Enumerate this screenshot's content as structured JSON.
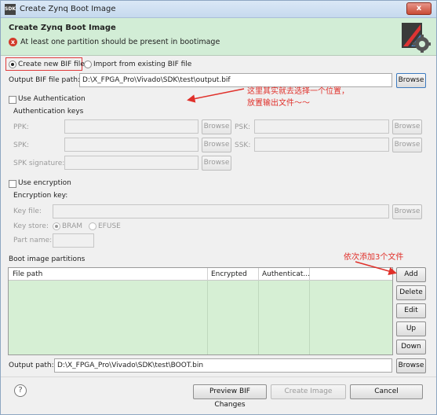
{
  "window": {
    "title": "Create Zynq Boot Image",
    "app_icon_text": "SDK",
    "close_label": "x"
  },
  "header": {
    "title": "Create Zynq Boot Image",
    "message": "At least one partition should be present in bootimage",
    "error_icon": "x"
  },
  "bif_mode": {
    "create_new_label": "Create new BIF file",
    "import_label": "Import from existing BIF file",
    "selected": "create_new"
  },
  "output_bif": {
    "label": "Output BIF file path:",
    "value": "D:\\X_FPGA_Pro\\Vivado\\SDK\\test\\output.bif",
    "browse": "Browse"
  },
  "authentication": {
    "checkbox_label": "Use Authentication",
    "keys_label": "Authentication keys",
    "ppk_label": "PPK:",
    "psk_label": "PSK:",
    "spk_label": "SPK:",
    "ssk_label": "SSK:",
    "spk_sig_label": "SPK signature:",
    "browse": "Browse"
  },
  "encryption": {
    "checkbox_label": "Use encryption",
    "key_section_label": "Encryption key:",
    "key_file_label": "Key file:",
    "key_store_label": "Key store:",
    "bram_label": "BRAM",
    "efuse_label": "EFUSE",
    "part_name_label": "Part name:",
    "browse": "Browse"
  },
  "partitions": {
    "section_label": "Boot image partitions",
    "columns": [
      "File path",
      "Encrypted",
      "Authenticat..."
    ],
    "buttons": {
      "add": "Add",
      "delete": "Delete",
      "edit": "Edit",
      "up": "Up",
      "down": "Down"
    }
  },
  "output_path": {
    "label": "Output path:",
    "value": "D:\\X_FPGA_Pro\\Vivado\\SDK\\test\\BOOT.bin",
    "browse": "Browse"
  },
  "footer": {
    "help_icon": "?",
    "preview": "Preview BIF Changes",
    "create": "Create Image",
    "cancel": "Cancel"
  },
  "annotations": {
    "note1_line1": "这里其实就去选择一个位置，",
    "note1_line2": "放置输出文件～～",
    "note2": "依次添加3个文件",
    "color": "#e0302a"
  }
}
